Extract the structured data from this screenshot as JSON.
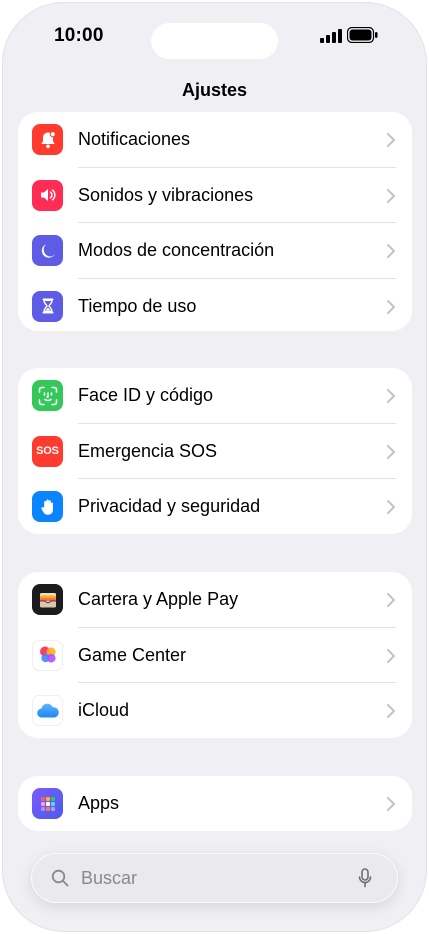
{
  "status_bar": {
    "time": "10:00"
  },
  "nav": {
    "title": "Ajustes"
  },
  "groups": [
    {
      "items": [
        {
          "label": "Notificaciones",
          "icon": "bell-icon",
          "color": "#ff3b30"
        },
        {
          "label": "Sonidos y vibraciones",
          "icon": "speaker-icon",
          "color": "#ff2d55"
        },
        {
          "label": "Modos de concentración",
          "icon": "moon-icon",
          "color": "#5e5ce6"
        },
        {
          "label": "Tiempo de uso",
          "icon": "hourglass-icon",
          "color": "#5e5ce6"
        }
      ]
    },
    {
      "items": [
        {
          "label": "Face ID y código",
          "icon": "faceid-icon",
          "color": "#34c759"
        },
        {
          "label": "Emergencia SOS",
          "icon": "sos-icon",
          "color": "#ff3b30",
          "icon_text": "SOS"
        },
        {
          "label": "Privacidad y seguridad",
          "icon": "hand-icon",
          "color": "#0a84ff"
        }
      ]
    },
    {
      "items": [
        {
          "label": "Cartera y Apple Pay",
          "icon": "wallet-icon",
          "color": "#1c1c1e"
        },
        {
          "label": "Game Center",
          "icon": "game-center-icon",
          "color": "#ffffff"
        },
        {
          "label": "iCloud",
          "icon": "cloud-icon",
          "color": "#ffffff"
        }
      ]
    },
    {
      "items": [
        {
          "label": "Apps",
          "icon": "apps-grid-icon",
          "color": "#5e5ce6"
        }
      ]
    }
  ],
  "search": {
    "placeholder": "Buscar"
  }
}
